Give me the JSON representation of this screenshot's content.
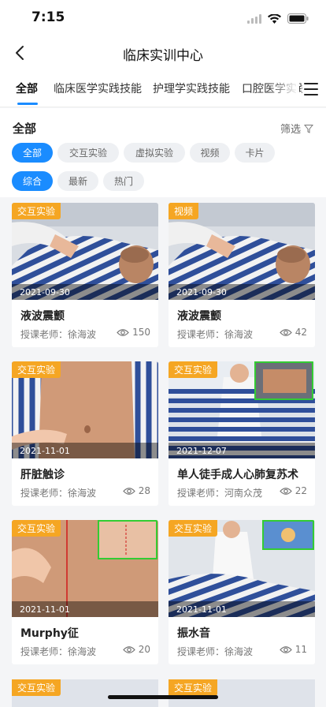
{
  "status": {
    "time": "7:15"
  },
  "nav": {
    "title": "临床实训中心"
  },
  "tabs": [
    {
      "label": "全部",
      "active": true
    },
    {
      "label": "临床医学实践技能",
      "active": false
    },
    {
      "label": "护理学实践技能",
      "active": false
    },
    {
      "label": "口腔医学实践",
      "active": false
    }
  ],
  "filter": {
    "section_title": "全部",
    "filter_label": "筛选",
    "type_chips": [
      {
        "label": "全部",
        "active": true
      },
      {
        "label": "交互实验",
        "active": false
      },
      {
        "label": "虚拟实验",
        "active": false
      },
      {
        "label": "视频",
        "active": false
      },
      {
        "label": "卡片",
        "active": false
      }
    ],
    "sort_chips": [
      {
        "label": "综合",
        "active": true
      },
      {
        "label": "最新",
        "active": false
      },
      {
        "label": "热门",
        "active": false
      }
    ]
  },
  "cards": [
    {
      "badge": "交互实验",
      "date": "2021-09-30",
      "title": "液波震颤",
      "teacher": "授课老师：徐海波",
      "views": "150",
      "thumb": "patient-lying"
    },
    {
      "badge": "视频",
      "date": "2021-09-30",
      "title": "液波震颤",
      "teacher": "授课老师：徐海波",
      "views": "42",
      "thumb": "patient-lying"
    },
    {
      "badge": "交互实验",
      "date": "2021-11-01",
      "title": "肝脏触诊",
      "teacher": "授课老师：徐海波",
      "views": "28",
      "thumb": "abdomen"
    },
    {
      "badge": "交互实验",
      "date": "2021-12-07",
      "title": "单人徒手成人心肺复苏术",
      "teacher": "授课老师：河南众茂",
      "views": "22",
      "thumb": "cpr"
    },
    {
      "badge": "交互实验",
      "date": "2021-11-01",
      "title": "Murphy征",
      "teacher": "授课老师：徐海波",
      "views": "20",
      "thumb": "murphy"
    },
    {
      "badge": "交互实验",
      "date": "2021-11-01",
      "title": "振水音",
      "teacher": "授课老师：徐海波",
      "views": "11",
      "thumb": "doctor-exam"
    }
  ],
  "peek_cards": [
    {
      "badge": "交互实验"
    },
    {
      "badge": "交互实验"
    }
  ],
  "colors": {
    "accent": "#1a8cff",
    "badge": "#f5a623"
  }
}
